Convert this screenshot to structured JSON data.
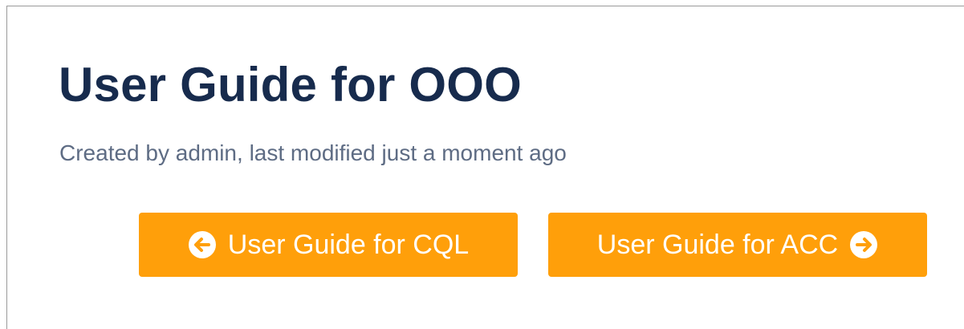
{
  "page": {
    "title": "User Guide for OOO",
    "byline": "Created by admin, last modified just a moment ago"
  },
  "navigation": {
    "previous": {
      "label": "User Guide for CQL",
      "icon": "arrow-left-circle-icon"
    },
    "next": {
      "label": "User Guide for ACC",
      "icon": "arrow-right-circle-icon"
    }
  },
  "colors": {
    "title": "#172b4d",
    "byline": "#5e6c84",
    "button_background": "#ff9f0a",
    "button_text": "#ffffff"
  }
}
